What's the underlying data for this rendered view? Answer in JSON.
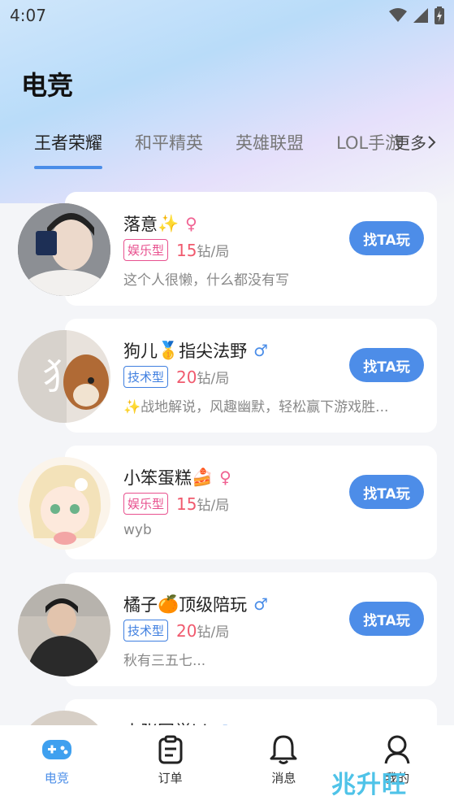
{
  "status": {
    "time": "4:07"
  },
  "page": {
    "title": "电竞"
  },
  "tabs": [
    {
      "label": "王者荣耀",
      "active": true
    },
    {
      "label": "和平精英",
      "active": false
    },
    {
      "label": "英雄联盟",
      "active": false
    },
    {
      "label": "LOL手游",
      "active": false
    }
  ],
  "more_label": "更多",
  "players": [
    {
      "name": "落意",
      "emoji": "✨",
      "gender": "♀",
      "tag": "娱乐型",
      "price": "15",
      "unit": "钻/局",
      "desc": "这个人很懒，什么都没有写",
      "button": "找TA玩"
    },
    {
      "name": "狗儿",
      "emoji": "🥇",
      "name2": "指尖法野",
      "gender": "♂",
      "tag": "技术型",
      "price": "20",
      "unit": "钻/局",
      "desc": "✨战地解说，风趣幽默，轻松赢下游戏胜...",
      "button": "找TA玩"
    },
    {
      "name": "小笨蛋糕",
      "emoji": "🍰",
      "gender": "♀",
      "tag": "娱乐型",
      "price": "15",
      "unit": "钻/局",
      "desc": "wyb",
      "button": "找TA玩"
    },
    {
      "name": "橘子",
      "emoji": "🍊",
      "name2": "顶级陪玩",
      "gender": "♂",
      "tag": "技术型",
      "price": "20",
      "unit": "钻/局",
      "desc": "秋有三五七...",
      "button": "找TA玩"
    },
    {
      "name": "小张同学bi",
      "gender": "♂"
    }
  ],
  "nav": [
    {
      "label": "电竞",
      "icon": "gamepad-icon",
      "active": true
    },
    {
      "label": "订单",
      "icon": "clipboard-icon",
      "active": false
    },
    {
      "label": "消息",
      "icon": "bell-icon",
      "active": false
    },
    {
      "label": "我的",
      "icon": "user-icon",
      "active": false
    }
  ],
  "watermark": "兆升旺",
  "colors": {
    "accent": "#4d8de8",
    "price": "#f05a6e",
    "female": "#f06292",
    "male": "#4a8de8"
  }
}
